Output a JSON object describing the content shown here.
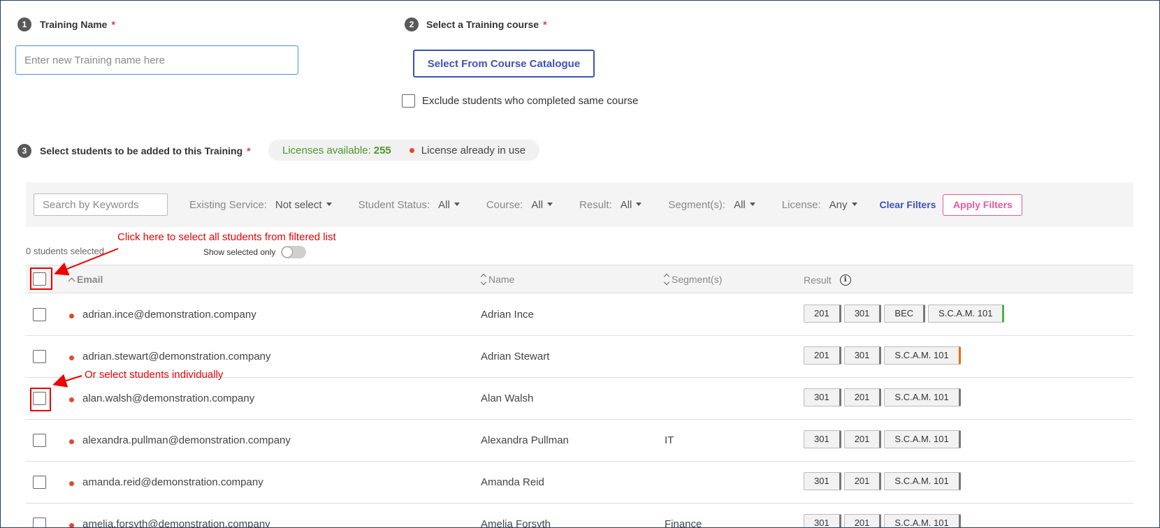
{
  "step1": {
    "num": "1",
    "label": "Training Name",
    "req": "*",
    "placeholder": "Enter new Training name here"
  },
  "step2": {
    "num": "2",
    "label": "Select a Training course",
    "req": "*",
    "button": "Select From Course Catalogue",
    "exclude_label": "Exclude students who completed same course"
  },
  "step3": {
    "num": "3",
    "label": "Select students to be added to this Training",
    "req": "*",
    "licenses_label": "Licenses available:",
    "licenses_count": "255",
    "license_in_use": "License already in use"
  },
  "filters": {
    "search_placeholder": "Search by Keywords",
    "items": [
      {
        "label": "Existing Service:",
        "value": "Not select"
      },
      {
        "label": "Student Status:",
        "value": "All"
      },
      {
        "label": "Course:",
        "value": "All"
      },
      {
        "label": "Result:",
        "value": "All"
      },
      {
        "label": "Segment(s):",
        "value": "All"
      },
      {
        "label": "License:",
        "value": "Any"
      }
    ],
    "clear": "Clear Filters",
    "apply": "Apply Filters"
  },
  "selection": {
    "count": "0 students selected",
    "show_selected": "Show selected only"
  },
  "columns": {
    "email": "Email",
    "name": "Name",
    "segment": "Segment(s)",
    "result": "Result"
  },
  "rows": [
    {
      "email": "adrian.ince@demonstration.company",
      "name": "Adrian Ince",
      "segment": "",
      "results": [
        {
          "label": "201",
          "accent": ""
        },
        {
          "label": "301",
          "accent": ""
        },
        {
          "label": "BEC",
          "accent": ""
        },
        {
          "label": "S.C.A.M. 101",
          "accent": "green"
        }
      ]
    },
    {
      "email": "adrian.stewart@demonstration.company",
      "name": "Adrian Stewart",
      "segment": "",
      "results": [
        {
          "label": "201",
          "accent": ""
        },
        {
          "label": "301",
          "accent": ""
        },
        {
          "label": "S.C.A.M. 101",
          "accent": "orange"
        }
      ]
    },
    {
      "email": "alan.walsh@demonstration.company",
      "name": "Alan Walsh",
      "segment": "",
      "results": [
        {
          "label": "301",
          "accent": ""
        },
        {
          "label": "201",
          "accent": ""
        },
        {
          "label": "S.C.A.M. 101",
          "accent": ""
        }
      ]
    },
    {
      "email": "alexandra.pullman@demonstration.company",
      "name": "Alexandra Pullman",
      "segment": "IT",
      "results": [
        {
          "label": "301",
          "accent": ""
        },
        {
          "label": "201",
          "accent": ""
        },
        {
          "label": "S.C.A.M. 101",
          "accent": ""
        }
      ]
    },
    {
      "email": "amanda.reid@demonstration.company",
      "name": "Amanda Reid",
      "segment": "",
      "results": [
        {
          "label": "301",
          "accent": ""
        },
        {
          "label": "201",
          "accent": ""
        },
        {
          "label": "S.C.A.M. 101",
          "accent": ""
        }
      ]
    },
    {
      "email": "amelia.forsyth@demonstration.company",
      "name": "Amelia Forsyth",
      "segment": "Finance",
      "results": [
        {
          "label": "301",
          "accent": ""
        },
        {
          "label": "201",
          "accent": ""
        },
        {
          "label": "S.C.A.M. 101",
          "accent": ""
        }
      ]
    }
  ],
  "annotations": {
    "select_all": "Click here to select all students from filtered list",
    "select_individual": "Or select students individually"
  },
  "colors": {
    "accent_blue": "#3f51b5",
    "apply_pink": "#e35a9a",
    "license_green": "#4a9a2a",
    "dot_red": "#e0492a",
    "annotation_red": "#e00000"
  }
}
